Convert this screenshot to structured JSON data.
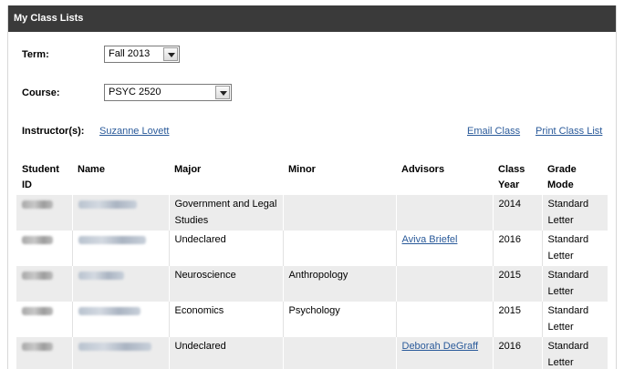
{
  "panel": {
    "title": "My Class Lists"
  },
  "form": {
    "term_label": "Term:",
    "term_value": "Fall 2013",
    "course_label": "Course:",
    "course_value": "PSYC 2520",
    "instructor_label": "Instructor(s):",
    "instructor_name": "Suzanne Lovett",
    "email_class_label": "Email Class",
    "print_list_label": "Print Class List"
  },
  "table": {
    "headers": {
      "student_id": "Student ID",
      "name": "Name",
      "major": "Major",
      "minor": "Minor",
      "advisors": "Advisors",
      "class_year": "Class Year",
      "grade_mode": "Grade Mode"
    },
    "rows": [
      {
        "major": "Government and Legal Studies",
        "minor": "",
        "advisor": "",
        "class_year": "2014",
        "grade_mode": "Standard Letter"
      },
      {
        "major": "Undeclared",
        "minor": "",
        "advisor": "Aviva Briefel",
        "class_year": "2016",
        "grade_mode": "Standard Letter"
      },
      {
        "major": "Neuroscience",
        "minor": "Anthropology",
        "advisor": "",
        "class_year": "2015",
        "grade_mode": "Standard Letter"
      },
      {
        "major": "Economics",
        "minor": "Psychology",
        "advisor": "",
        "class_year": "2015",
        "grade_mode": "Standard Letter"
      },
      {
        "major": "Undeclared",
        "minor": "",
        "advisor": "Deborah DeGraff",
        "class_year": "2016",
        "grade_mode": "Standard Letter"
      }
    ]
  },
  "icons": {
    "dropdown": "chevron-down-icon"
  },
  "colors": {
    "header_bg": "#3a3a3a",
    "link": "#2a5a9a",
    "row_stripe": "#ececec"
  }
}
